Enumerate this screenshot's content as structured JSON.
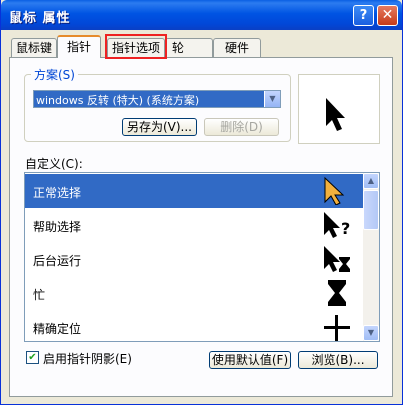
{
  "window": {
    "title": "鼠标 属性",
    "help_glyph": "?",
    "close_glyph": "✕"
  },
  "tabs": [
    "鼠标键",
    "指针",
    "指针选项",
    "轮",
    "硬件"
  ],
  "scheme": {
    "label": "方案(S)",
    "selected": "windows 反转 (特大) (系统方案)",
    "save_as_label": "另存为(V)...",
    "delete_label": "删除(D)"
  },
  "custom": {
    "label": "自定义(C):",
    "items": [
      {
        "label": "正常选择",
        "icon": "arrow-cursor-icon",
        "selected": true
      },
      {
        "label": "帮助选择",
        "icon": "help-select-cursor-icon",
        "selected": false
      },
      {
        "label": "后台运行",
        "icon": "working-in-background-cursor-icon",
        "selected": false
      },
      {
        "label": "忙",
        "icon": "busy-hourglass-icon",
        "selected": false
      },
      {
        "label": "精确定位",
        "icon": "precision-crosshair-icon",
        "selected": false
      }
    ]
  },
  "shadow": {
    "label": "启用指针阴影(E)",
    "checked": true
  },
  "buttons": {
    "use_default": "使用默认值(F)",
    "browse": "浏览(B)..."
  },
  "colors": {
    "selection": "#316ac5",
    "title_bar": "#0054e3",
    "highlight_box": "#ee2222"
  }
}
